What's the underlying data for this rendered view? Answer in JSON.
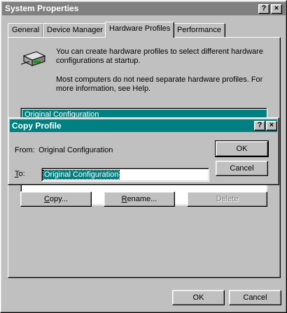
{
  "window": {
    "title": "System Properties",
    "help_btn": "?",
    "close_btn": "×"
  },
  "tabs": [
    {
      "label": "General"
    },
    {
      "label": "Device Manager"
    },
    {
      "label": "Hardware Profiles"
    },
    {
      "label": "Performance"
    }
  ],
  "panel": {
    "info_line1": "You can create hardware profiles to select different hardware configurations at startup.",
    "info_line2": "Most computers do not need separate hardware profiles. For more information, see Help.",
    "profiles": [
      "Original Configuration"
    ],
    "copy_btn": "Copy...",
    "rename_btn": "Rename...",
    "delete_btn": "Delete"
  },
  "footer": {
    "ok_btn": "OK",
    "cancel_btn": "Cancel"
  },
  "dialog": {
    "title": "Copy Profile",
    "help_btn": "?",
    "close_btn": "×",
    "from_label": "From:",
    "from_value": "Original Configuration",
    "to_label": "To:",
    "to_value": "Original Configuration",
    "ok_btn": "OK",
    "cancel_btn": "Cancel"
  },
  "colors": {
    "title_active": "#008080",
    "title_inactive": "#808080",
    "selection": "#008080"
  }
}
